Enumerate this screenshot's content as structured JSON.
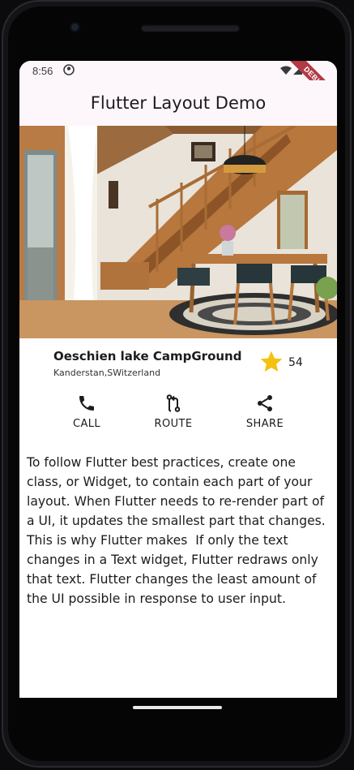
{
  "status_bar": {
    "time": "8:56"
  },
  "debug_banner": "DEBUG",
  "app_bar": {
    "title": "Flutter Layout Demo"
  },
  "place": {
    "name": "Oeschien lake CampGround",
    "location": "Kanderstan,SWitzerland",
    "stars": "54"
  },
  "actions": [
    {
      "label": "CALL",
      "icon": "phone-icon"
    },
    {
      "label": "ROUTE",
      "icon": "route-icon"
    },
    {
      "label": "SHARE",
      "icon": "share-icon"
    }
  ],
  "description": "To follow Flutter best practices, create one class, or Widget, to contain each part of your layout. When Flutter needs to re-render part of a UI, it updates the smallest part that changes. This is why Flutter makes  If only the text changes in a Text widget, Flutter redraws only that text. Flutter changes the least amount of the UI possible in response to user input.",
  "colors": {
    "app_bar_background": "#fdf7fc",
    "star": "#f4c10f",
    "debug_banner": "#b13a44"
  }
}
